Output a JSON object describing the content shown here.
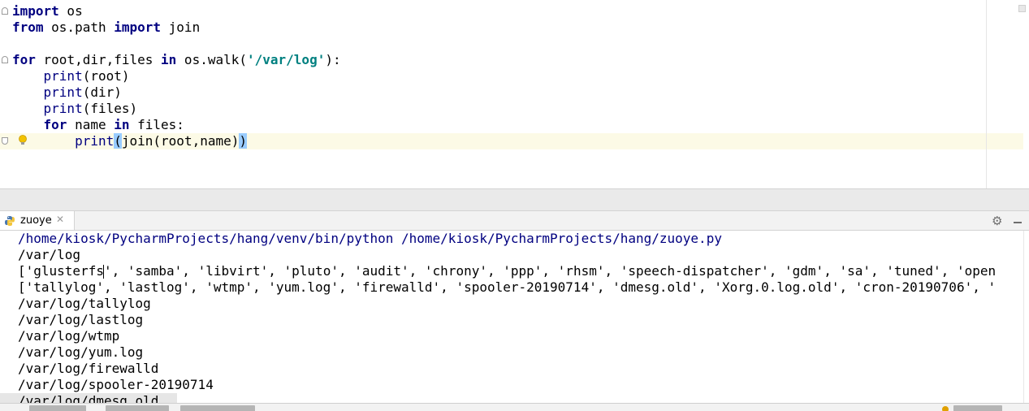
{
  "editor": {
    "lines": [
      [
        {
          "t": "import",
          "c": "kw"
        },
        {
          "t": " os",
          "c": ""
        }
      ],
      [
        {
          "t": "from",
          "c": "kw"
        },
        {
          "t": " os.path ",
          "c": ""
        },
        {
          "t": "import",
          "c": "kw"
        },
        {
          "t": " join",
          "c": ""
        }
      ],
      [],
      [
        {
          "t": "for",
          "c": "kw"
        },
        {
          "t": " root,dir,files ",
          "c": ""
        },
        {
          "t": "in",
          "c": "kw"
        },
        {
          "t": " os.walk(",
          "c": ""
        },
        {
          "t": "'/var/log'",
          "c": "str"
        },
        {
          "t": "):",
          "c": ""
        }
      ],
      [
        {
          "t": "    ",
          "c": ""
        },
        {
          "t": "print",
          "c": "fn"
        },
        {
          "t": "(root)",
          "c": ""
        }
      ],
      [
        {
          "t": "    ",
          "c": ""
        },
        {
          "t": "print",
          "c": "fn"
        },
        {
          "t": "(dir)",
          "c": ""
        }
      ],
      [
        {
          "t": "    ",
          "c": ""
        },
        {
          "t": "print",
          "c": "fn"
        },
        {
          "t": "(files)",
          "c": ""
        }
      ],
      [
        {
          "t": "    ",
          "c": ""
        },
        {
          "t": "for",
          "c": "kw"
        },
        {
          "t": " name ",
          "c": ""
        },
        {
          "t": "in",
          "c": "kw"
        },
        {
          "t": " files:",
          "c": ""
        }
      ],
      [
        {
          "t": "        ",
          "c": ""
        },
        {
          "t": "print",
          "c": "fn"
        },
        {
          "t": "(",
          "c": "brace"
        },
        {
          "t": "join(root,name)",
          "c": ""
        },
        {
          "t": ")",
          "c": "brace"
        }
      ]
    ],
    "current_line": 8,
    "fold_markers": {
      "top": [
        0,
        3
      ],
      "bottom": [
        8
      ]
    },
    "accent_colors": {
      "keyword": "#000080",
      "string": "#008080",
      "current_line": "#fcfae6",
      "brace_match": "#99ccff"
    }
  },
  "run_panel": {
    "tab_label": "zuoye",
    "close_glyph": "✕",
    "settings_icon": "gear-icon",
    "hide_icon": "hide-panel-icon"
  },
  "console": {
    "lines": [
      {
        "text": "/home/kiosk/PycharmProjects/hang/venv/bin/python /home/kiosk/PycharmProjects/hang/zuoye.py",
        "kind": "cmd"
      },
      {
        "text": "/var/log",
        "kind": "out"
      },
      {
        "text": "['glusterfs', 'samba', 'libvirt', 'pluto', 'audit', 'chrony', 'ppp', 'rhsm', 'speech-dispatcher', 'gdm', 'sa', 'tuned', 'open",
        "kind": "out",
        "caret_after": 11
      },
      {
        "text": "['tallylog', 'lastlog', 'wtmp', 'yum.log', 'firewalld', 'spooler-20190714', 'dmesg.old', 'Xorg.0.log.old', 'cron-20190706', '",
        "kind": "out"
      },
      {
        "text": "/var/log/tallylog",
        "kind": "out"
      },
      {
        "text": "/var/log/lastlog",
        "kind": "out"
      },
      {
        "text": "/var/log/wtmp",
        "kind": "out"
      },
      {
        "text": "/var/log/yum.log",
        "kind": "out"
      },
      {
        "text": "/var/log/firewalld",
        "kind": "out"
      },
      {
        "text": "/var/log/spooler-20190714",
        "kind": "out"
      },
      {
        "text": "/var/log/dmesg.old",
        "kind": "sel"
      }
    ]
  }
}
